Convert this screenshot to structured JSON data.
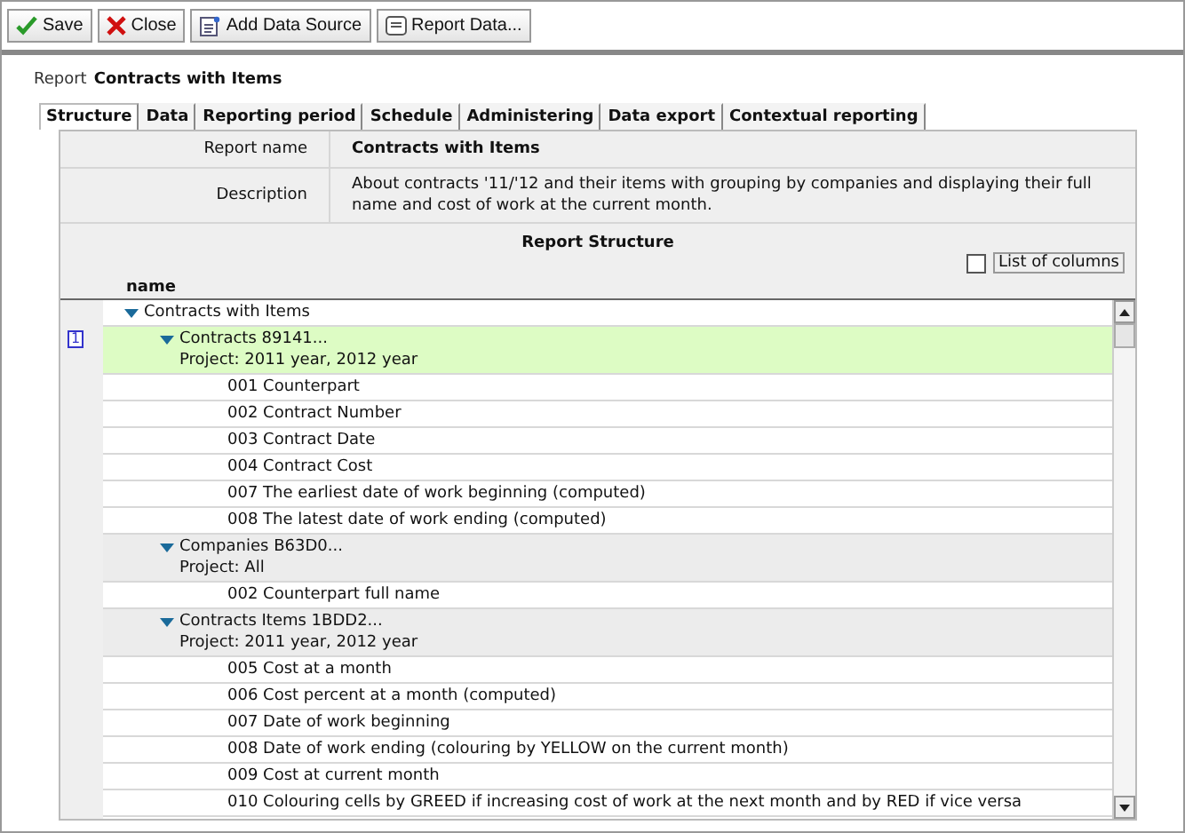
{
  "toolbar": {
    "buttons": [
      {
        "kind": "save",
        "label": "Save"
      },
      {
        "kind": "close",
        "label": "Close"
      },
      {
        "kind": "add-source",
        "label": "Add Data Source"
      },
      {
        "kind": "report-data",
        "label": "Report Data..."
      }
    ]
  },
  "report_title": {
    "prefix": "Report",
    "name": "Contracts with Items"
  },
  "tabs": [
    {
      "label": "Structure",
      "selected": true
    },
    {
      "label": "Data",
      "selected": false
    },
    {
      "label": "Reporting period",
      "selected": false
    },
    {
      "label": "Schedule",
      "selected": false
    },
    {
      "label": "Administering",
      "selected": false
    },
    {
      "label": "Data export",
      "selected": false
    },
    {
      "label": "Contextual reporting",
      "selected": false
    }
  ],
  "form": {
    "fields": [
      {
        "label": "Report name",
        "value": "Contracts with Items",
        "kind": "title"
      },
      {
        "label": "Description",
        "value": "About contracts '11/'12 and their items with grouping by companies and displaying their full name and cost of work at the current month.",
        "kind": "text"
      }
    ]
  },
  "structure": {
    "title": "Report Structure",
    "list_of_columns": {
      "label": "List of columns",
      "checked": false
    },
    "column": "name",
    "tree": [
      {
        "label": "Contracts with Items",
        "selected": false,
        "expanded": true,
        "children": [
          {
            "label": "Contracts 89141...",
            "subtitle": "Project: 2011 year, 2012 year",
            "badge": "1",
            "selected": true,
            "expanded": true,
            "children": [
              {
                "label": "001 Counterpart",
                "selected": false
              },
              {
                "label": "002 Contract Number",
                "selected": false
              },
              {
                "label": "003 Contract Date",
                "selected": false
              },
              {
                "label": "004 Contract Cost",
                "selected": false
              },
              {
                "label": "007 The earliest date of work beginning (computed)",
                "selected": false
              },
              {
                "label": "008 The latest date of work ending (computed)",
                "selected": false
              }
            ]
          },
          {
            "label": "Companies B63D0...",
            "subtitle": "Project: All",
            "selected": false,
            "expanded": true,
            "children": [
              {
                "label": "002 Counterpart full name",
                "selected": false
              }
            ]
          },
          {
            "label": "Contracts Items 1BDD2...",
            "subtitle": "Project: 2011 year, 2012 year",
            "selected": false,
            "expanded": true,
            "children": [
              {
                "label": "005 Cost at a month",
                "selected": false
              },
              {
                "label": "006 Cost percent at a month (computed)",
                "selected": false
              },
              {
                "label": "007 Date of work beginning",
                "selected": false
              },
              {
                "label": "008 Date of work ending (colouring by YELLOW on the current month)",
                "selected": false
              },
              {
                "label": "009 Cost at current month",
                "selected": false
              },
              {
                "label": "010 Colouring cells by GREED if increasing cost of work at the next month and by RED if vice versa",
                "selected": false
              }
            ]
          }
        ]
      }
    ]
  }
}
